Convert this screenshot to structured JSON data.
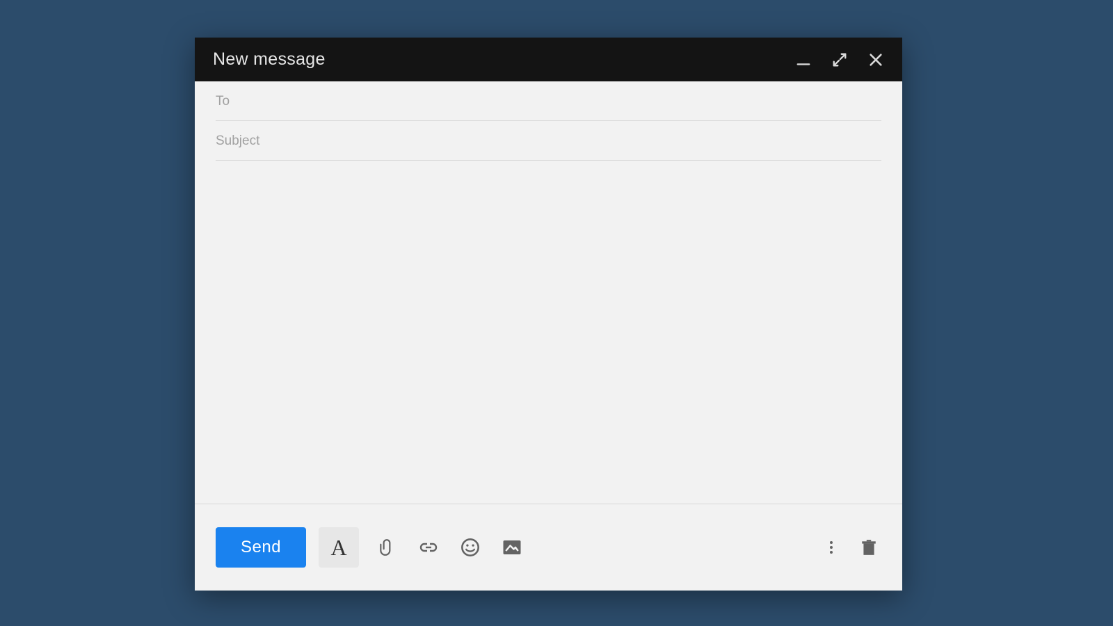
{
  "titlebar": {
    "title": "New message"
  },
  "fields": {
    "to_placeholder": "To",
    "to_value": "",
    "subject_placeholder": "Subject",
    "subject_value": ""
  },
  "body": {
    "content": ""
  },
  "toolbar": {
    "send_label": "Send",
    "format_glyph": "A"
  },
  "colors": {
    "page_bg": "#2c4c6b",
    "compose_bg": "#f2f2f2",
    "header_bg": "#141414",
    "send_bg": "#1a82ef"
  }
}
